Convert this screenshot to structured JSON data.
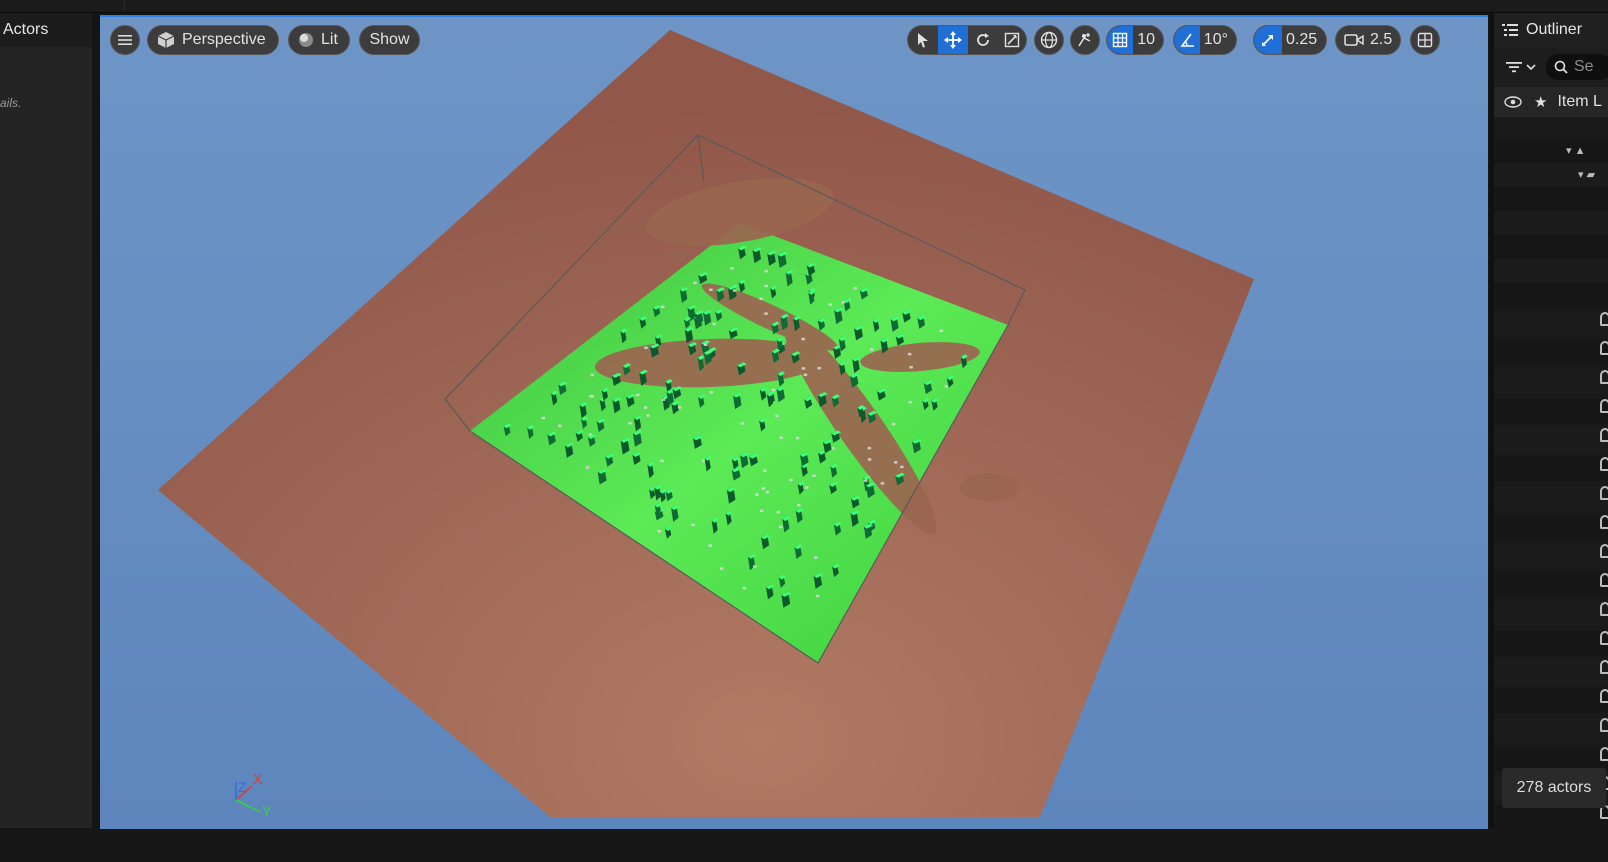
{
  "left_panel": {
    "header": "Actors",
    "hint": "ails."
  },
  "viewport": {
    "view_mode": "Perspective",
    "lighting": "Lit",
    "show_label": "Show",
    "grid_snap": "10",
    "rotation_snap": "10°",
    "scale_snap": "0.25",
    "camera_speed": "2.5",
    "axis_labels": {
      "x": "X",
      "y": "Y",
      "z": "Z"
    }
  },
  "outliner": {
    "title": "Outliner",
    "search_placeholder": "Se",
    "column_label": "Item L",
    "actor_count": "278 actors"
  },
  "colors": {
    "accent": "#1f6fd6",
    "sky": "#6a91c4",
    "ground": "#a06b55",
    "grass": "#4fd84f"
  }
}
